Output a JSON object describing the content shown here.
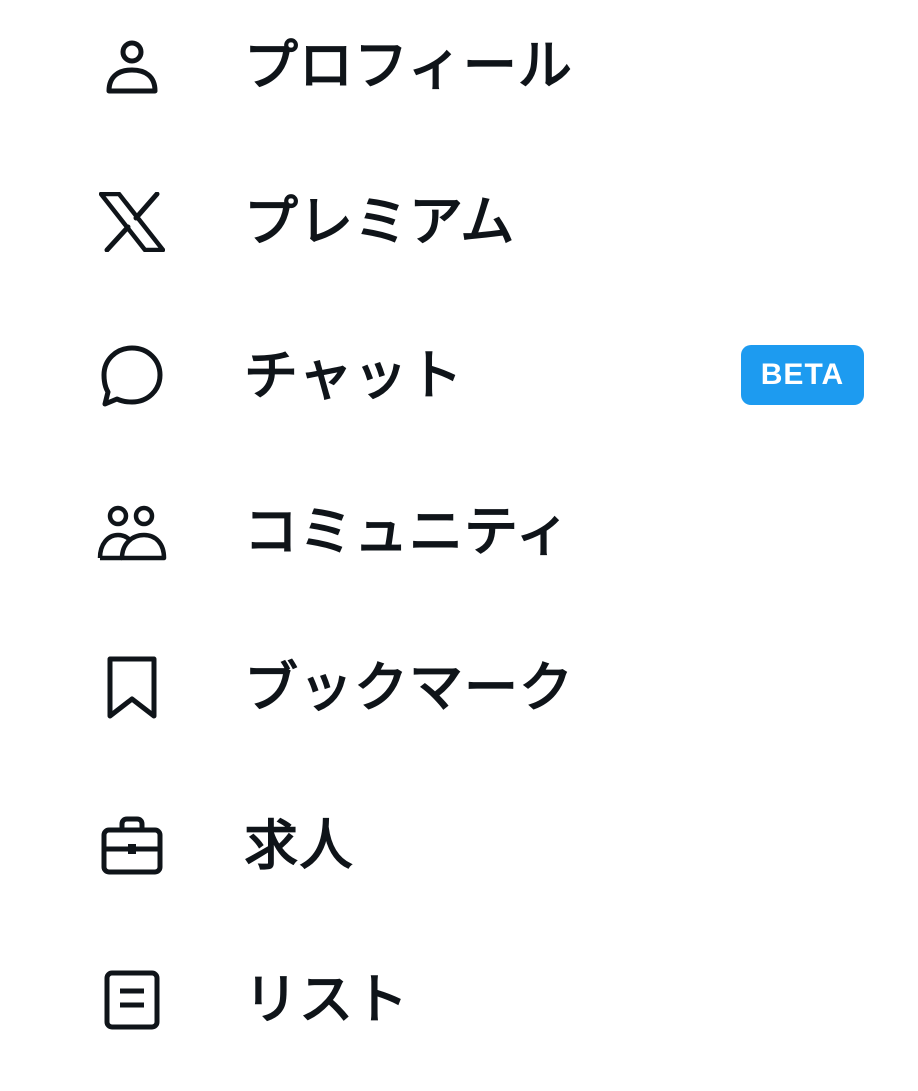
{
  "menu": {
    "items": [
      {
        "id": "profile",
        "label": "プロフィール",
        "icon": "person-icon"
      },
      {
        "id": "premium",
        "label": "プレミアム",
        "icon": "x-logo-icon"
      },
      {
        "id": "chat",
        "label": "チャット",
        "icon": "chat-bubble-icon",
        "badge": "BETA"
      },
      {
        "id": "communities",
        "label": "コミュニティ",
        "icon": "people-icon"
      },
      {
        "id": "bookmarks",
        "label": "ブックマーク",
        "icon": "bookmark-icon"
      },
      {
        "id": "jobs",
        "label": "求人",
        "icon": "briefcase-icon"
      },
      {
        "id": "lists",
        "label": "リスト",
        "icon": "list-document-icon"
      }
    ]
  },
  "colors": {
    "text": "#0f1419",
    "badge_bg": "#1d9bf0",
    "badge_text": "#ffffff"
  }
}
